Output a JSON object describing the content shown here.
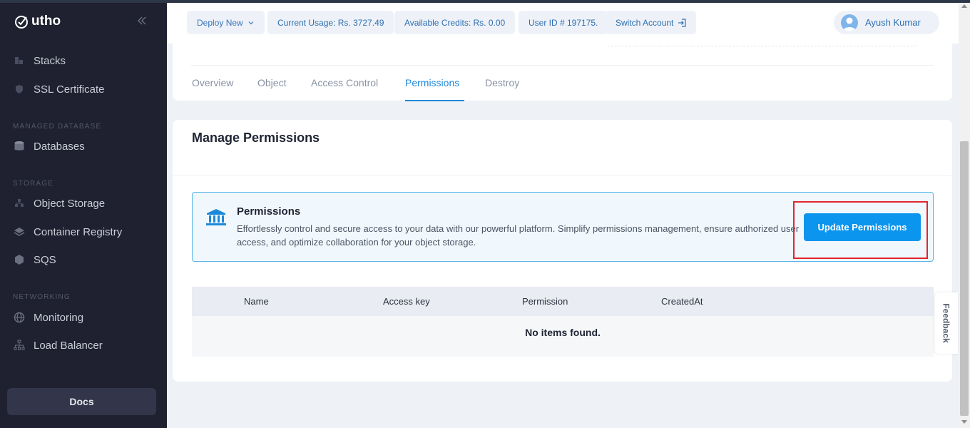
{
  "sidebar": {
    "logo_text": "utho",
    "items": [
      {
        "label": "Stacks",
        "icon": "stacks-icon"
      },
      {
        "label": "SSL Certificate",
        "icon": "shield-icon"
      },
      {
        "label": "Databases",
        "icon": "database-icon"
      },
      {
        "label": "Object Storage",
        "icon": "object-storage-icon"
      },
      {
        "label": "Container Registry",
        "icon": "layers-icon"
      },
      {
        "label": "SQS",
        "icon": "queue-icon"
      },
      {
        "label": "Monitoring",
        "icon": "globe-icon"
      },
      {
        "label": "Load Balancer",
        "icon": "network-icon"
      }
    ],
    "sections": {
      "managed_database": "MANAGED DATABASE",
      "storage": "STORAGE",
      "networking": "NETWORKING"
    },
    "docs_label": "Docs"
  },
  "header": {
    "deploy_label": "Deploy New",
    "current_usage": "Current Usage: Rs. 3727.49",
    "available_credits": "Available Credits: Rs. 0.00",
    "user_id": "User ID # 197175.",
    "switch_account": "Switch Account",
    "user_name": "Ayush Kumar"
  },
  "tabs": [
    {
      "label": "Overview"
    },
    {
      "label": "Object"
    },
    {
      "label": "Access Control"
    },
    {
      "label": "Permissions"
    },
    {
      "label": "Destroy"
    }
  ],
  "active_tab": "Permissions",
  "main": {
    "title": "Manage Permissions",
    "info": {
      "title": "Permissions",
      "description": "Effortlessly control and secure access to your data with our powerful platform. Simplify permissions management, ensure authorized user access, and optimize collaboration for your object storage.",
      "button_label": "Update Permissions"
    },
    "table": {
      "columns": [
        "Name",
        "Access key",
        "Permission",
        "CreatedAt"
      ],
      "empty_text": "No items found."
    }
  },
  "feedback_label": "Feedback",
  "colors": {
    "sidebar_bg": "#1f2130",
    "accent": "#1e88d8",
    "button": "#0b95ee",
    "highlight": "#e3262d"
  }
}
